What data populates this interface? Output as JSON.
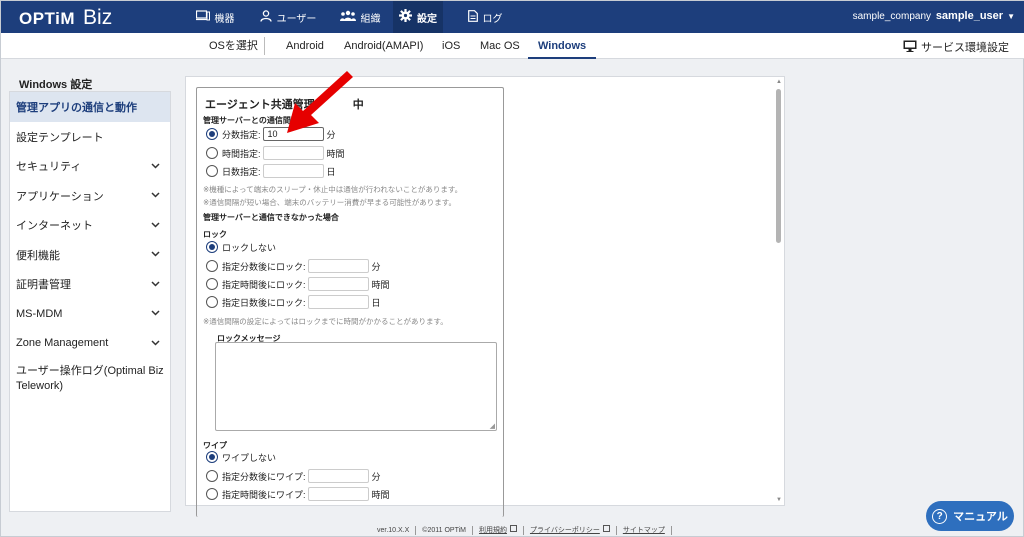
{
  "app": {
    "logo_brand": "OPTiM",
    "logo_product": "Biz"
  },
  "nav": {
    "devices": "機器",
    "users": "ユーザー",
    "org": "組織",
    "settings": "設定",
    "logs": "ログ"
  },
  "account": {
    "company": "sample_company",
    "user": "sample_user"
  },
  "subnav": {
    "select_os": "OSを選択",
    "tabs": [
      "Android",
      "Android(AMAPI)",
      "iOS",
      "Mac OS",
      "Windows"
    ],
    "active_tab": "Windows",
    "service_env": "サービス環境設定"
  },
  "sidebar": {
    "title": "Windows 設定",
    "items": [
      {
        "label": "管理アプリの通信と動作",
        "active": true
      },
      {
        "label": "設定テンプレート"
      },
      {
        "label": "セキュリティ"
      },
      {
        "label": "アプリケーション"
      },
      {
        "label": "インターネット"
      },
      {
        "label": "便利機能"
      },
      {
        "label": "証明書管理"
      },
      {
        "label": "MS-MDM"
      },
      {
        "label": "Zone Management"
      },
      {
        "label": "ユーザー操作ログ(Optimal Biz Telework)"
      }
    ]
  },
  "panel": {
    "title": "エージェント共通管理",
    "title_suffix": "中",
    "comm_interval_label": "管理サーバーとの通信間隔",
    "minutes_label": "分数指定:",
    "minutes_value": "10",
    "minutes_unit": "分",
    "hours_label": "時間指定:",
    "hours_unit": "時間",
    "days_label": "日数指定:",
    "days_unit": "日",
    "note1": "※機種によって端末のスリープ・休止中は通信が行われないことがあります。",
    "note2": "※通信間隔が短い場合、端末のバッテリー消費が早まる可能性があります。",
    "no_comm_label": "管理サーバーと通信できなかった場合",
    "lock_label": "ロック",
    "no_lock": "ロックしない",
    "lock_after_min": "指定分数後にロック:",
    "lock_after_hours": "指定時間後にロック:",
    "lock_after_days": "指定日数後にロック:",
    "lock_note": "※通信間隔の設定によってはロックまでに時間がかかることがあります。",
    "lock_msg_label": "ロックメッセージ",
    "wipe_label": "ワイプ",
    "no_wipe": "ワイプしない",
    "wipe_after_min": "指定分数後にワイプ:",
    "wipe_after_hours": "指定時間後にワイプ:"
  },
  "footer": {
    "version": "ver.10.X.X",
    "copyright": "©2011 OPTiM",
    "terms": "利用規約",
    "privacy": "プライバシーポリシー",
    "sitemap": "サイトマップ"
  },
  "manual_button": "マニュアル",
  "colors": {
    "header_bg": "#1d3e7c",
    "accent": "#2e6fbe",
    "arrow": "#e60000"
  }
}
